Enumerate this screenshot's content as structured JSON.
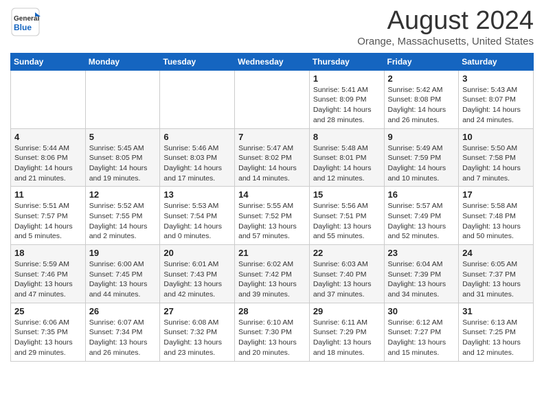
{
  "header": {
    "logo_general": "General",
    "logo_blue": "Blue",
    "month_title": "August 2024",
    "location": "Orange, Massachusetts, United States"
  },
  "calendar": {
    "days_of_week": [
      "Sunday",
      "Monday",
      "Tuesday",
      "Wednesday",
      "Thursday",
      "Friday",
      "Saturday"
    ],
    "weeks": [
      [
        {
          "day": "",
          "info": ""
        },
        {
          "day": "",
          "info": ""
        },
        {
          "day": "",
          "info": ""
        },
        {
          "day": "",
          "info": ""
        },
        {
          "day": "1",
          "info": "Sunrise: 5:41 AM\nSunset: 8:09 PM\nDaylight: 14 hours\nand 28 minutes."
        },
        {
          "day": "2",
          "info": "Sunrise: 5:42 AM\nSunset: 8:08 PM\nDaylight: 14 hours\nand 26 minutes."
        },
        {
          "day": "3",
          "info": "Sunrise: 5:43 AM\nSunset: 8:07 PM\nDaylight: 14 hours\nand 24 minutes."
        }
      ],
      [
        {
          "day": "4",
          "info": "Sunrise: 5:44 AM\nSunset: 8:06 PM\nDaylight: 14 hours\nand 21 minutes."
        },
        {
          "day": "5",
          "info": "Sunrise: 5:45 AM\nSunset: 8:05 PM\nDaylight: 14 hours\nand 19 minutes."
        },
        {
          "day": "6",
          "info": "Sunrise: 5:46 AM\nSunset: 8:03 PM\nDaylight: 14 hours\nand 17 minutes."
        },
        {
          "day": "7",
          "info": "Sunrise: 5:47 AM\nSunset: 8:02 PM\nDaylight: 14 hours\nand 14 minutes."
        },
        {
          "day": "8",
          "info": "Sunrise: 5:48 AM\nSunset: 8:01 PM\nDaylight: 14 hours\nand 12 minutes."
        },
        {
          "day": "9",
          "info": "Sunrise: 5:49 AM\nSunset: 7:59 PM\nDaylight: 14 hours\nand 10 minutes."
        },
        {
          "day": "10",
          "info": "Sunrise: 5:50 AM\nSunset: 7:58 PM\nDaylight: 14 hours\nand 7 minutes."
        }
      ],
      [
        {
          "day": "11",
          "info": "Sunrise: 5:51 AM\nSunset: 7:57 PM\nDaylight: 14 hours\nand 5 minutes."
        },
        {
          "day": "12",
          "info": "Sunrise: 5:52 AM\nSunset: 7:55 PM\nDaylight: 14 hours\nand 2 minutes."
        },
        {
          "day": "13",
          "info": "Sunrise: 5:53 AM\nSunset: 7:54 PM\nDaylight: 14 hours\nand 0 minutes."
        },
        {
          "day": "14",
          "info": "Sunrise: 5:55 AM\nSunset: 7:52 PM\nDaylight: 13 hours\nand 57 minutes."
        },
        {
          "day": "15",
          "info": "Sunrise: 5:56 AM\nSunset: 7:51 PM\nDaylight: 13 hours\nand 55 minutes."
        },
        {
          "day": "16",
          "info": "Sunrise: 5:57 AM\nSunset: 7:49 PM\nDaylight: 13 hours\nand 52 minutes."
        },
        {
          "day": "17",
          "info": "Sunrise: 5:58 AM\nSunset: 7:48 PM\nDaylight: 13 hours\nand 50 minutes."
        }
      ],
      [
        {
          "day": "18",
          "info": "Sunrise: 5:59 AM\nSunset: 7:46 PM\nDaylight: 13 hours\nand 47 minutes."
        },
        {
          "day": "19",
          "info": "Sunrise: 6:00 AM\nSunset: 7:45 PM\nDaylight: 13 hours\nand 44 minutes."
        },
        {
          "day": "20",
          "info": "Sunrise: 6:01 AM\nSunset: 7:43 PM\nDaylight: 13 hours\nand 42 minutes."
        },
        {
          "day": "21",
          "info": "Sunrise: 6:02 AM\nSunset: 7:42 PM\nDaylight: 13 hours\nand 39 minutes."
        },
        {
          "day": "22",
          "info": "Sunrise: 6:03 AM\nSunset: 7:40 PM\nDaylight: 13 hours\nand 37 minutes."
        },
        {
          "day": "23",
          "info": "Sunrise: 6:04 AM\nSunset: 7:39 PM\nDaylight: 13 hours\nand 34 minutes."
        },
        {
          "day": "24",
          "info": "Sunrise: 6:05 AM\nSunset: 7:37 PM\nDaylight: 13 hours\nand 31 minutes."
        }
      ],
      [
        {
          "day": "25",
          "info": "Sunrise: 6:06 AM\nSunset: 7:35 PM\nDaylight: 13 hours\nand 29 minutes."
        },
        {
          "day": "26",
          "info": "Sunrise: 6:07 AM\nSunset: 7:34 PM\nDaylight: 13 hours\nand 26 minutes."
        },
        {
          "day": "27",
          "info": "Sunrise: 6:08 AM\nSunset: 7:32 PM\nDaylight: 13 hours\nand 23 minutes."
        },
        {
          "day": "28",
          "info": "Sunrise: 6:10 AM\nSunset: 7:30 PM\nDaylight: 13 hours\nand 20 minutes."
        },
        {
          "day": "29",
          "info": "Sunrise: 6:11 AM\nSunset: 7:29 PM\nDaylight: 13 hours\nand 18 minutes."
        },
        {
          "day": "30",
          "info": "Sunrise: 6:12 AM\nSunset: 7:27 PM\nDaylight: 13 hours\nand 15 minutes."
        },
        {
          "day": "31",
          "info": "Sunrise: 6:13 AM\nSunset: 7:25 PM\nDaylight: 13 hours\nand 12 minutes."
        }
      ]
    ]
  }
}
